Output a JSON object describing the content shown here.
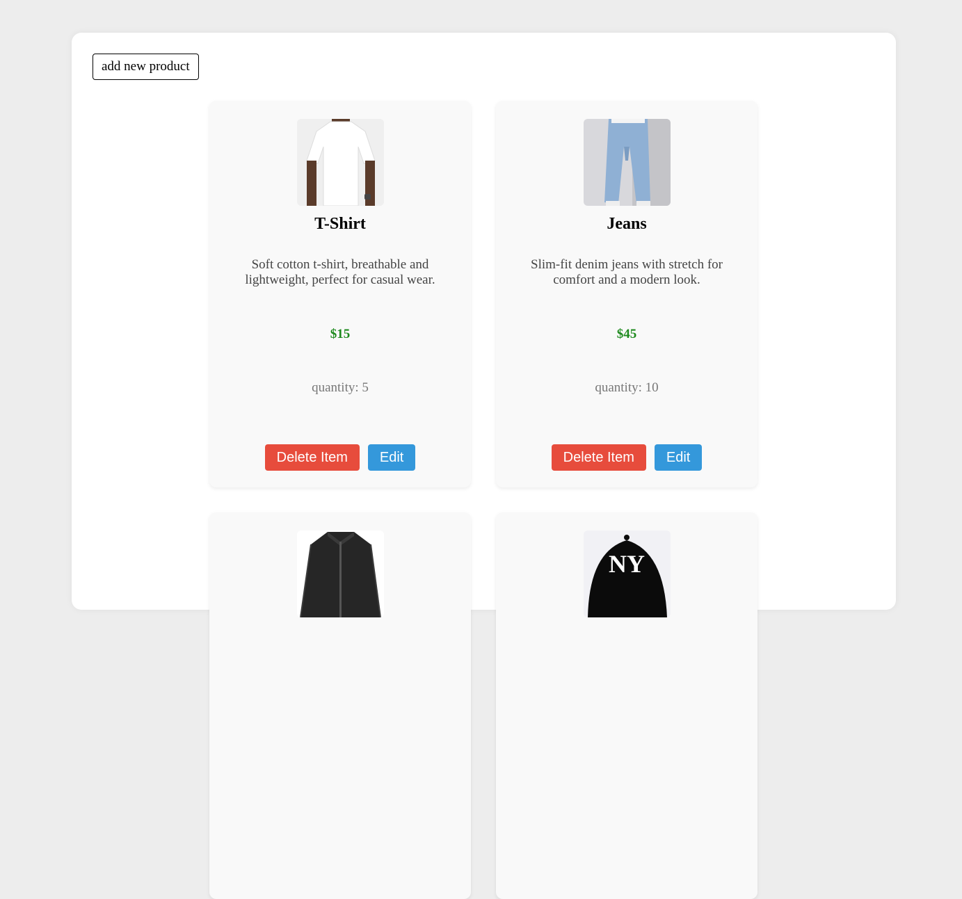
{
  "toolbar": {
    "add_label": "add new product"
  },
  "products": [
    {
      "name": "T-Shirt",
      "description": "Soft cotton t-shirt, breathable and lightweight, perfect for casual wear.",
      "price": "$15",
      "quantity_label": "quantity:",
      "quantity": "5",
      "image": "white-tshirt-photo",
      "delete_label": "Delete Item",
      "edit_label": "Edit"
    },
    {
      "name": "Jeans",
      "description": "Slim-fit denim jeans with stretch for comfort and a modern look.",
      "price": "$45",
      "quantity_label": "quantity:",
      "quantity": "10",
      "image": "blue-jeans-photo",
      "delete_label": "Delete Item",
      "edit_label": "Edit"
    },
    {
      "image": "black-jacket-photo"
    },
    {
      "image": "black-ny-cap-photo"
    }
  ],
  "colors": {
    "background": "#ededed",
    "delete": "#e74c3c",
    "edit": "#3498db",
    "price": "#1e8a1e"
  }
}
